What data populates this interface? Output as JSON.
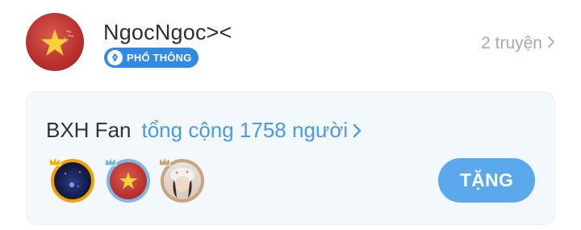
{
  "header": {
    "user_name": "NgocNgoc><",
    "badge_label": "PHỔ THÔNG",
    "stories_count": "2 truyện",
    "icons": [
      "avatar",
      "pen-nib-icon",
      "chevron-right-icon"
    ]
  },
  "fan_card": {
    "label": "BXH Fan",
    "total": "tổng cộng 1758 người",
    "gift_label": "TẶNG",
    "fans": [
      {
        "rank": 1,
        "ring_color": "#f0a100",
        "crown_color": "#f5b400"
      },
      {
        "rank": 2,
        "ring_color": "#7fb6ea",
        "crown_color": "#7fb6ea"
      },
      {
        "rank": 3,
        "ring_color": "#c9a57a",
        "crown_color": "#c9a57a"
      }
    ]
  },
  "colors": {
    "accent": "#4a9ae8",
    "badge": "#2f8ae6",
    "button": "#5ba8ec",
    "card_bg": "#f3f8fd",
    "muted": "#a9a9a9"
  }
}
